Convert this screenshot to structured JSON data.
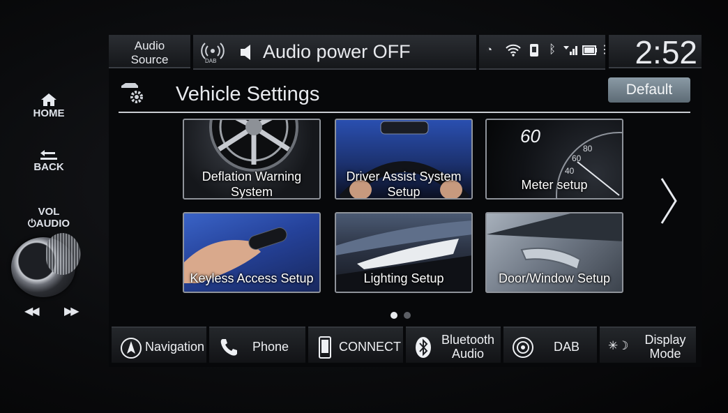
{
  "hardware": {
    "home_label": "HOME",
    "back_label": "BACK",
    "vol_label": "VOL",
    "audio_label": "AUDIO"
  },
  "topbar": {
    "audio_source_line1": "Audio",
    "audio_source_line2": "Source",
    "dab_icon_text": "DAB",
    "now_playing": "Audio power OFF",
    "clock": "2:52"
  },
  "page": {
    "title": "Vehicle Settings",
    "default_button": "Default"
  },
  "tiles": [
    {
      "line1": "Deflation Warning",
      "line2": "System"
    },
    {
      "line1": "Driver Assist System",
      "line2": "Setup"
    },
    {
      "line1": "Meter setup",
      "speed_value": "60",
      "gauge_marks": [
        "80",
        "60",
        "40"
      ]
    },
    {
      "line1": "Keyless Access Setup"
    },
    {
      "line1": "Lighting Setup"
    },
    {
      "line1": "Door/Window Setup"
    }
  ],
  "pagination": {
    "current_page": 1,
    "total_pages": 2
  },
  "bottom_nav": [
    {
      "line1": "Navigation",
      "icon": "navigation-icon"
    },
    {
      "line1": "Phone",
      "icon": "phone-icon"
    },
    {
      "line1": "CONNECT",
      "icon": "smartphone-icon"
    },
    {
      "line1": "Bluetooth",
      "line2": "Audio",
      "icon": "bluetooth-icon"
    },
    {
      "line1": "DAB",
      "icon": "dab-icon"
    },
    {
      "line1": "Display",
      "line2": "Mode",
      "icon": "display-mode-icon"
    }
  ],
  "colors": {
    "accent_default_button": "#7a8a95",
    "screen_bg": "#07080a",
    "text": "#e8eaee"
  }
}
